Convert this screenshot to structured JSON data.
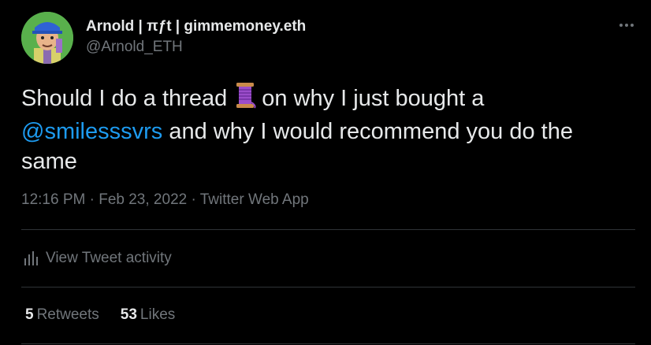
{
  "author": {
    "display_name": "Arnold | πƒt | gimmemoney.eth",
    "handle": "@Arnold_ETH"
  },
  "tweet": {
    "text_part1": "Should I do a thread",
    "text_part2": "on why I just bought a",
    "mention": "@smilesssvrs",
    "text_part3": " and why I would recommend you do the same",
    "emoji_icon": "spool-of-thread-icon"
  },
  "meta": {
    "time": "12:16 PM",
    "separator": " · ",
    "date": "Feb 23, 2022",
    "source": "Twitter Web App"
  },
  "activity": {
    "label": "View Tweet activity"
  },
  "stats": {
    "retweets_count": "5",
    "retweets_label": "Retweets",
    "likes_count": "53",
    "likes_label": "Likes"
  },
  "colors": {
    "background": "#000000",
    "text": "#e7e9ea",
    "secondary": "#71767b",
    "accent": "#1d9bf0",
    "divider": "#2f3336"
  }
}
